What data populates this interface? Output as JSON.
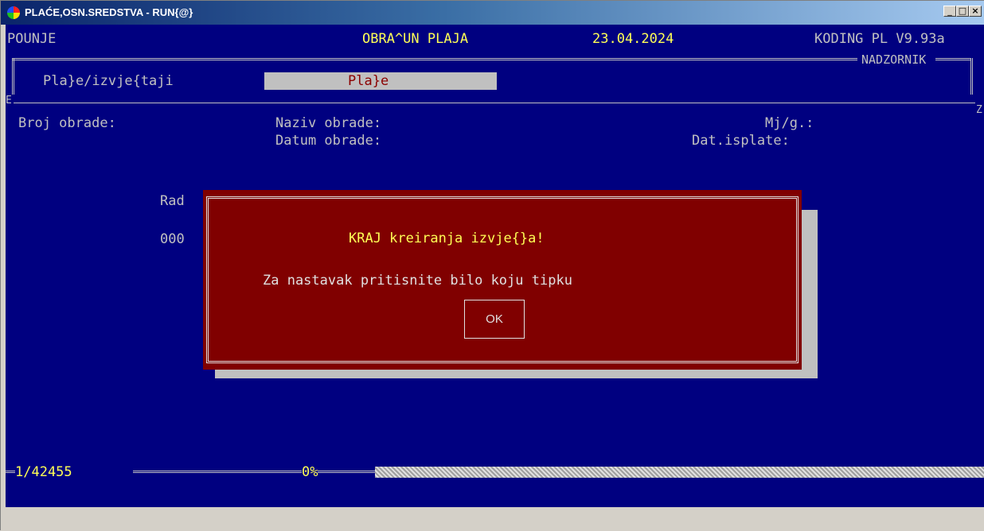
{
  "window": {
    "title": "PLAĆE,OSN.SREDSTVA - RUN{@}",
    "icon": "app-color-wheel-icon",
    "buttons": {
      "minimize": "_",
      "maximize": "□",
      "close": "×"
    }
  },
  "header": {
    "left": "POUNJE",
    "center": "OBRA^UN PLAJA",
    "date": "23.04.2024",
    "version": "KODING PL V9.93a",
    "user": "NADZORNIK"
  },
  "menu": {
    "item_label": "Pla}e/izvje{taji",
    "selected_value": "Pla}e"
  },
  "frame_edge": {
    "left": "E",
    "right": "Z"
  },
  "form": {
    "broj_obrade": "Broj obrade:",
    "naziv_obrade": "Naziv obrade:",
    "datum_obrade": "Datum obrade:",
    "mjg": "Mj/g.:",
    "dat_isplate": "Dat.isplate:",
    "rad_partial": "Rad",
    "num_partial": "000"
  },
  "dialog": {
    "title": "KRAJ kreiranja izvje{}a!",
    "message": "Za nastavak pritisnite bilo koju tipku",
    "ok_label": "OK"
  },
  "progress": {
    "counter": "1/42455",
    "percent_label": "0%",
    "percent_value": 0
  },
  "colors": {
    "screen_bg": "#000080",
    "dialog_bg": "#800000",
    "highlight_text": "#ffff55",
    "normal_text": "#c0c0c0"
  }
}
